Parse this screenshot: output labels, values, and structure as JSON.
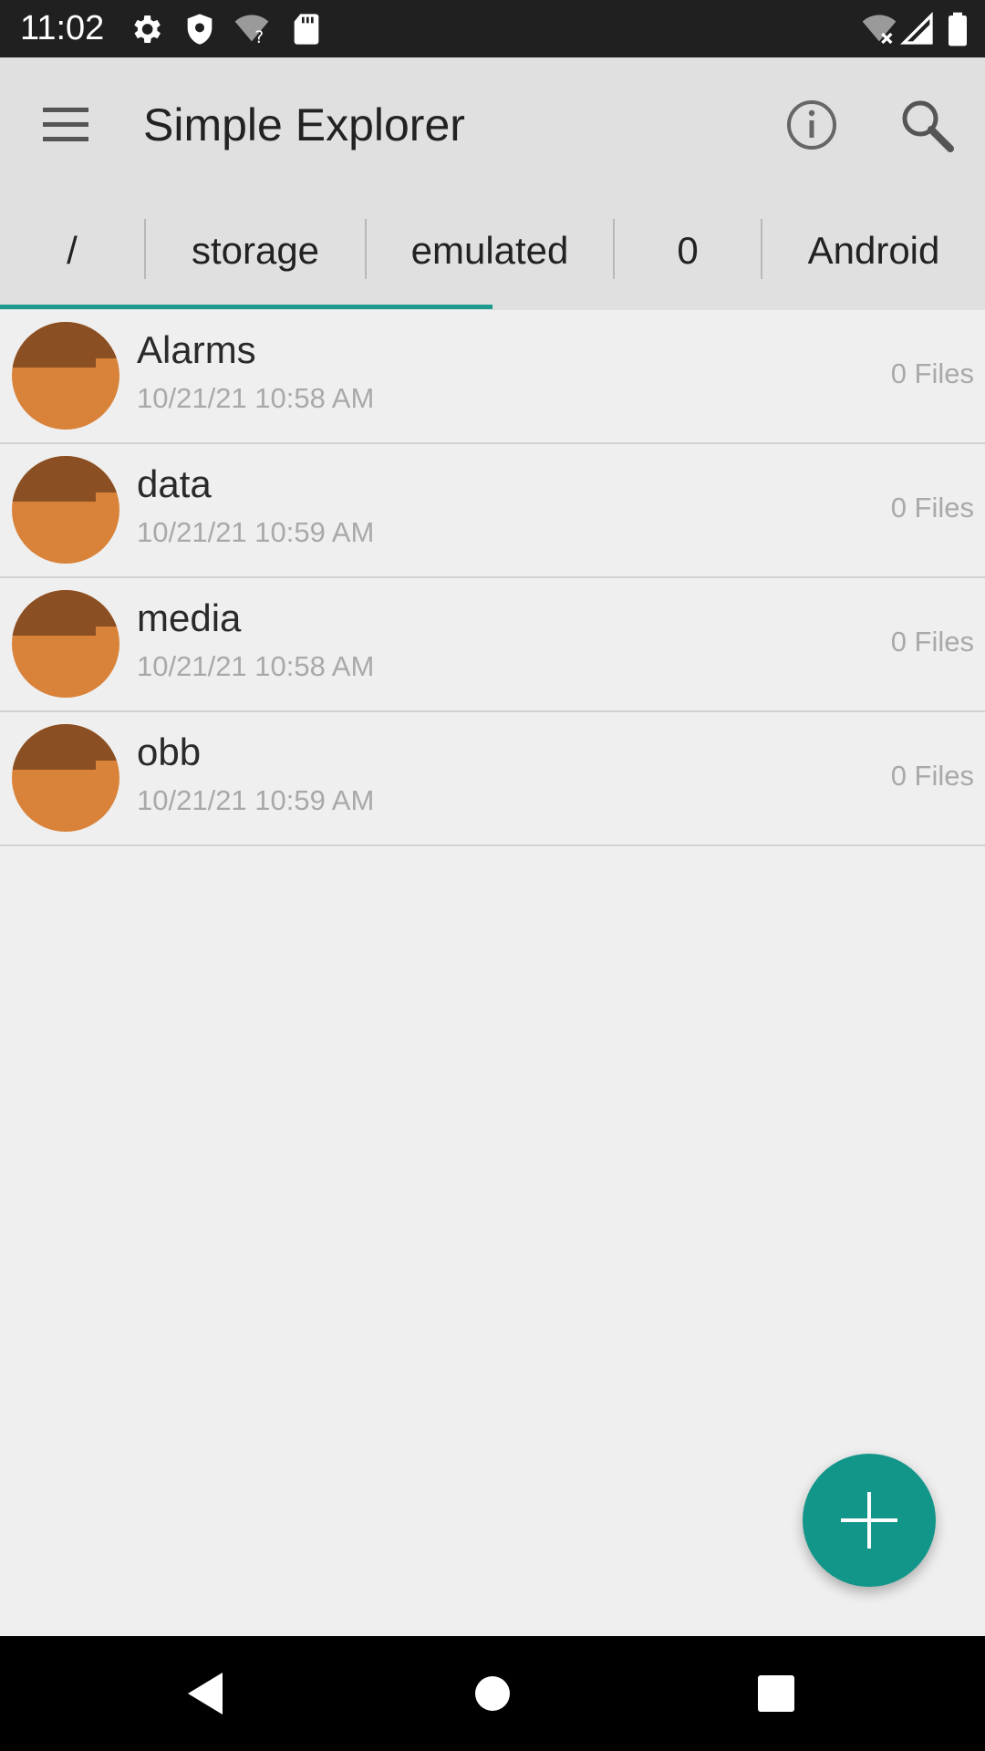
{
  "status_bar": {
    "time": "11:02",
    "left_icons": [
      "gear-icon",
      "shield-icon",
      "wifi-question-icon",
      "sd-card-icon"
    ],
    "right_icons": [
      "wifi-off-icon",
      "signal-icon",
      "battery-icon"
    ]
  },
  "app_bar": {
    "title": "Simple Explorer",
    "menu_icon": "menu-icon",
    "info_icon": "info-icon",
    "search_icon": "search-icon"
  },
  "breadcrumbs": [
    {
      "label": "/"
    },
    {
      "label": "storage"
    },
    {
      "label": "emulated"
    },
    {
      "label": "0"
    },
    {
      "label": "Android"
    }
  ],
  "files": [
    {
      "name": "Alarms",
      "date": "10/21/21 10:58 AM",
      "count": "0 Files"
    },
    {
      "name": "data",
      "date": "10/21/21 10:59 AM",
      "count": "0 Files"
    },
    {
      "name": "media",
      "date": "10/21/21 10:58 AM",
      "count": "0 Files"
    },
    {
      "name": "obb",
      "date": "10/21/21 10:59 AM",
      "count": "0 Files"
    }
  ],
  "fab": {
    "icon": "plus-icon"
  },
  "nav_bar": {
    "icons": [
      "back-icon",
      "home-icon",
      "recents-icon"
    ]
  },
  "colors": {
    "accent": "#13968a",
    "folder_light": "#d98239",
    "folder_dark": "#8a4f22",
    "app_bar": "#e0e0e0",
    "background": "#efefef"
  }
}
